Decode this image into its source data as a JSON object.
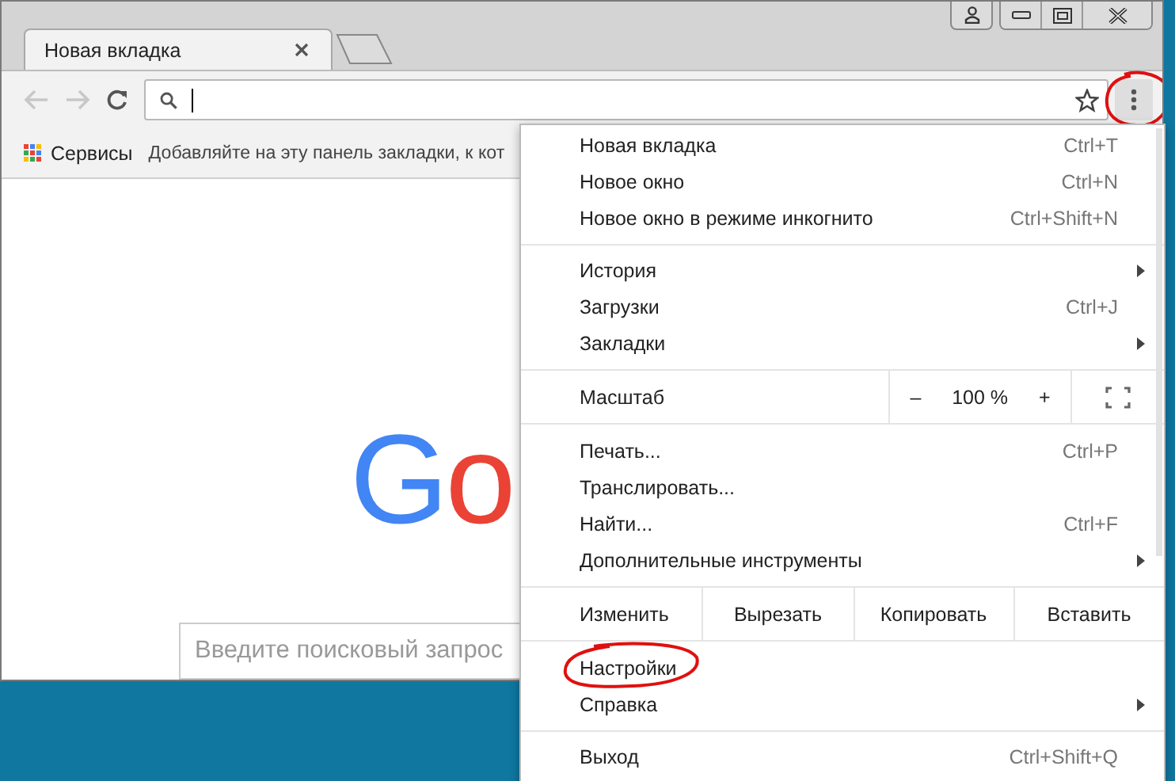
{
  "tab": {
    "title": "Новая вкладка",
    "selected": true
  },
  "toolbar": {
    "menu_button_circled": true
  },
  "bookmarks": {
    "apps_label": "Сервисы",
    "hint": "Добавляйте на эту панель закладки, к кот"
  },
  "page": {
    "logo": [
      {
        "letter": "G",
        "color": "#4285f4"
      },
      {
        "letter": "o",
        "color": "#ea4335"
      }
    ],
    "search_placeholder": "Введите поисковый запрос"
  },
  "menu": [
    {
      "kind": "item",
      "label": "Новая вкладка",
      "shortcut": "Ctrl+T",
      "submenu": false,
      "circled": false
    },
    {
      "kind": "item",
      "label": "Новое окно",
      "shortcut": "Ctrl+N",
      "submenu": false,
      "circled": false
    },
    {
      "kind": "item",
      "label": "Новое окно в режиме инкогнито",
      "shortcut": "Ctrl+Shift+N",
      "submenu": false,
      "circled": false
    },
    {
      "kind": "separator"
    },
    {
      "kind": "item",
      "label": "История",
      "submenu": true,
      "circled": false
    },
    {
      "kind": "item",
      "label": "Загрузки",
      "shortcut": "Ctrl+J",
      "submenu": false,
      "circled": false
    },
    {
      "kind": "item",
      "label": "Закладки",
      "submenu": true,
      "circled": false
    },
    {
      "kind": "zoom",
      "label": "Масштаб",
      "minus": "–",
      "value": "100 %",
      "plus": "+"
    },
    {
      "kind": "item",
      "label": "Печать...",
      "shortcut": "Ctrl+P",
      "submenu": false,
      "circled": false
    },
    {
      "kind": "item",
      "label": "Транслировать...",
      "submenu": false,
      "circled": false
    },
    {
      "kind": "item",
      "label": "Найти...",
      "shortcut": "Ctrl+F",
      "submenu": false,
      "circled": false
    },
    {
      "kind": "item",
      "label": "Дополнительные инструменты",
      "submenu": true,
      "circled": false
    },
    {
      "kind": "edit",
      "label": "Изменить",
      "buttons": [
        "Вырезать",
        "Копировать",
        "Вставить"
      ]
    },
    {
      "kind": "item",
      "label": "Настройки",
      "submenu": false,
      "circled": true
    },
    {
      "kind": "item",
      "label": "Справка",
      "submenu": true,
      "circled": false
    },
    {
      "kind": "separator"
    },
    {
      "kind": "item",
      "label": "Выход",
      "shortcut": "Ctrl+Shift+Q",
      "submenu": false,
      "circled": false
    }
  ]
}
